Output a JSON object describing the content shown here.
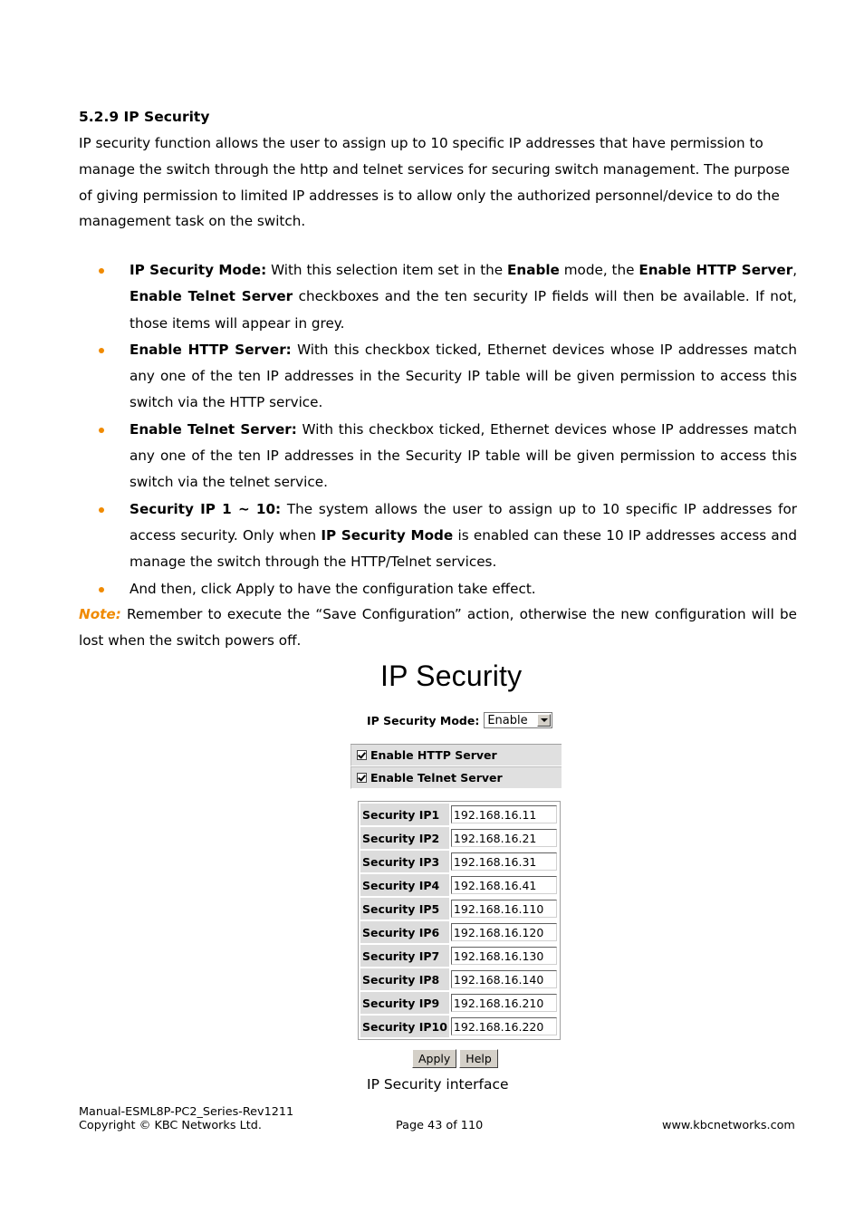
{
  "section": {
    "heading": "5.2.9  IP Security",
    "intro": "IP security function allows the user to assign up to 10 specific IP addresses that have permission to manage the switch through the http and telnet services for securing switch management. The purpose of giving permission to limited IP addresses is to allow only the authorized personnel/device to do the management task on the switch."
  },
  "bullets": [
    {
      "term": "IP Security Mode:",
      "parts": [
        {
          "text": " With this selection item set in the ",
          "bold": false
        },
        {
          "text": "Enable",
          "bold": true
        },
        {
          "text": " mode, the ",
          "bold": false
        },
        {
          "text": "Enable HTTP Server",
          "bold": true
        },
        {
          "text": ", ",
          "bold": false
        },
        {
          "text": "Enable Telnet Server",
          "bold": true
        },
        {
          "text": " checkboxes and the ten security IP fields will then be available. If not, those items will appear in grey.",
          "bold": false
        }
      ]
    },
    {
      "term": "Enable HTTP Server:",
      "parts": [
        {
          "text": " With this checkbox ticked, Ethernet devices whose IP addresses match any one of the ten IP addresses in the Security IP table will be given permission to access this switch via the HTTP service.",
          "bold": false
        }
      ]
    },
    {
      "term": "Enable Telnet Server:",
      "parts": [
        {
          "text": " With this checkbox ticked, Ethernet devices whose IP addresses match any one of the ten IP addresses in the Security IP table will be given permission to access this switch via the telnet service.",
          "bold": false
        }
      ]
    },
    {
      "term": "Security IP 1 ~ 10:",
      "parts": [
        {
          "text": " The system allows the user to assign up to 10 specific IP addresses for access security. Only when ",
          "bold": false
        },
        {
          "text": "IP Security Mode",
          "bold": true
        },
        {
          "text": " is enabled can these 10 IP addresses access and manage the switch through the HTTP/Telnet services.",
          "bold": false
        }
      ]
    },
    {
      "term": "",
      "parts": [
        {
          "text": "And then, click Apply to have the configuration take effect.",
          "bold": false
        }
      ]
    }
  ],
  "note": {
    "label": "Note:",
    "text": " Remember to execute the “Save Configuration” action, otherwise the new configuration will be lost when the switch powers off."
  },
  "ui": {
    "title": "IP Security",
    "mode_label": "IP Security Mode:",
    "mode_value": "Enable",
    "checkboxes": [
      {
        "label": "Enable HTTP Server",
        "checked": true
      },
      {
        "label": "Enable Telnet Server",
        "checked": true
      }
    ],
    "security_ips": [
      {
        "label": "Security IP1",
        "value": "192.168.16.11"
      },
      {
        "label": "Security IP2",
        "value": "192.168.16.21"
      },
      {
        "label": "Security IP3",
        "value": "192.168.16.31"
      },
      {
        "label": "Security IP4",
        "value": "192.168.16.41"
      },
      {
        "label": "Security IP5",
        "value": "192.168.16.110"
      },
      {
        "label": "Security IP6",
        "value": "192.168.16.120"
      },
      {
        "label": "Security IP7",
        "value": "192.168.16.130"
      },
      {
        "label": "Security IP8",
        "value": "192.168.16.140"
      },
      {
        "label": "Security IP9",
        "value": "192.168.16.210"
      },
      {
        "label": "Security IP10",
        "value": "192.168.16.220"
      }
    ],
    "apply_label": "Apply",
    "help_label": "Help"
  },
  "caption": "IP Security interface",
  "footer": {
    "manual": "Manual-ESML8P-PC2_Series-Rev1211",
    "copyright": "Copyright © KBC Networks Ltd.",
    "page": "Page 43 of 110",
    "website": "www.kbcnetworks.com"
  },
  "colors": {
    "accent_orange": "#f08a00"
  }
}
